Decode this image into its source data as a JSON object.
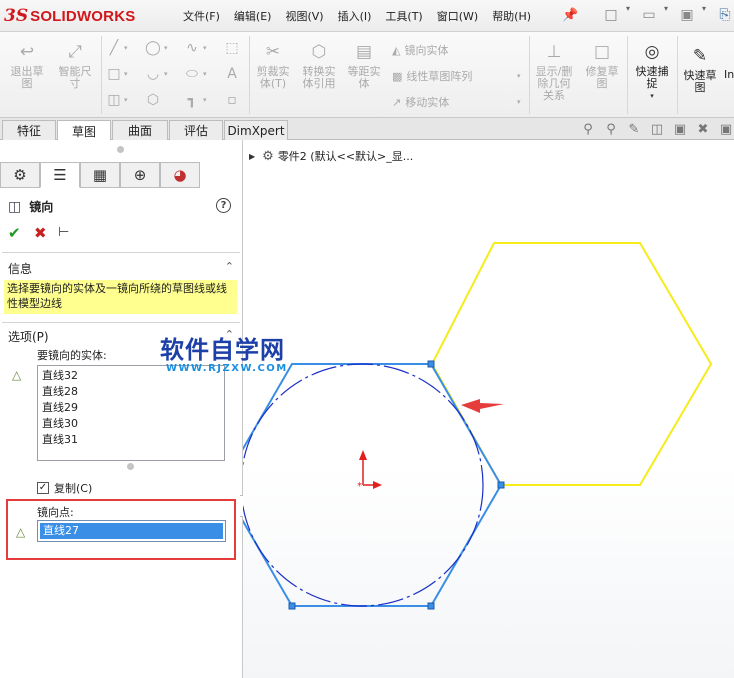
{
  "app": {
    "brand_prefix": "3S",
    "brand_name": "SOLIDWORKS"
  },
  "menu": [
    "文件(F)",
    "编辑(E)",
    "视图(V)",
    "插入(I)",
    "工具(T)",
    "窗口(W)",
    "帮助(H)"
  ],
  "qat_icons": [
    "new-file-icon",
    "open-file-icon",
    "save-icon",
    "print-icon"
  ],
  "ribbon": {
    "exit_sketch": "退出草\n图",
    "smart_dim": "智能尺\n寸",
    "trim": "剪裁实\n体(T)",
    "convert": "转换实\n体引用",
    "offset": "等距实\n体",
    "mirror_entities": "镜向实体",
    "linear_pattern": "线性草图阵列",
    "move_entities": "移动实体",
    "show_delete_rel": "显示/删\n除几何\n关系",
    "repair_sketch": "修复草\n图",
    "rapid_snap": "快速捕\n捉",
    "rapid_sketch": "快速草\n图",
    "overflow": "In"
  },
  "tabs": [
    "特征",
    "草图",
    "曲面",
    "评估",
    "DimXpert"
  ],
  "active_tab": 1,
  "view_icons": [
    "zoom-fit-icon",
    "zoom-area-icon",
    "previous-view-icon",
    "section-view-icon",
    "view-orientation-icon",
    "display-style-icon"
  ],
  "panel_tabs": [
    "feature-manager-icon",
    "property-manager-icon",
    "configuration-manager-icon",
    "dimxpert-manager-icon",
    "display-manager-icon"
  ],
  "pm": {
    "title": "镜向",
    "help": "?",
    "info_header": "信息",
    "info_text": "选择要镜向的实体及一镜向所绕的草图线或线性模型边线",
    "options_header": "选项(P)",
    "entities_label": "要镜向的实体:",
    "entities": [
      "直线32",
      "直线28",
      "直线29",
      "直线30",
      "直线31"
    ],
    "copy_label": "复制(C)",
    "copy_checked": true,
    "mirror_label": "镜向点:",
    "mirror_value": "直线27"
  },
  "tree": {
    "part_label": "零件2  (默认<<默认>_显..."
  },
  "watermark": {
    "line1": "软件自学网",
    "line2": "WWW.RJZXW.COM"
  },
  "colors": {
    "sketch_blue": "#3a8ee6",
    "hexagon_yellow": "#f5ec1a",
    "highlight_red": "#e63c3c",
    "info_yellow": "#ffff8f",
    "circle_navy": "#1a2fc8"
  }
}
